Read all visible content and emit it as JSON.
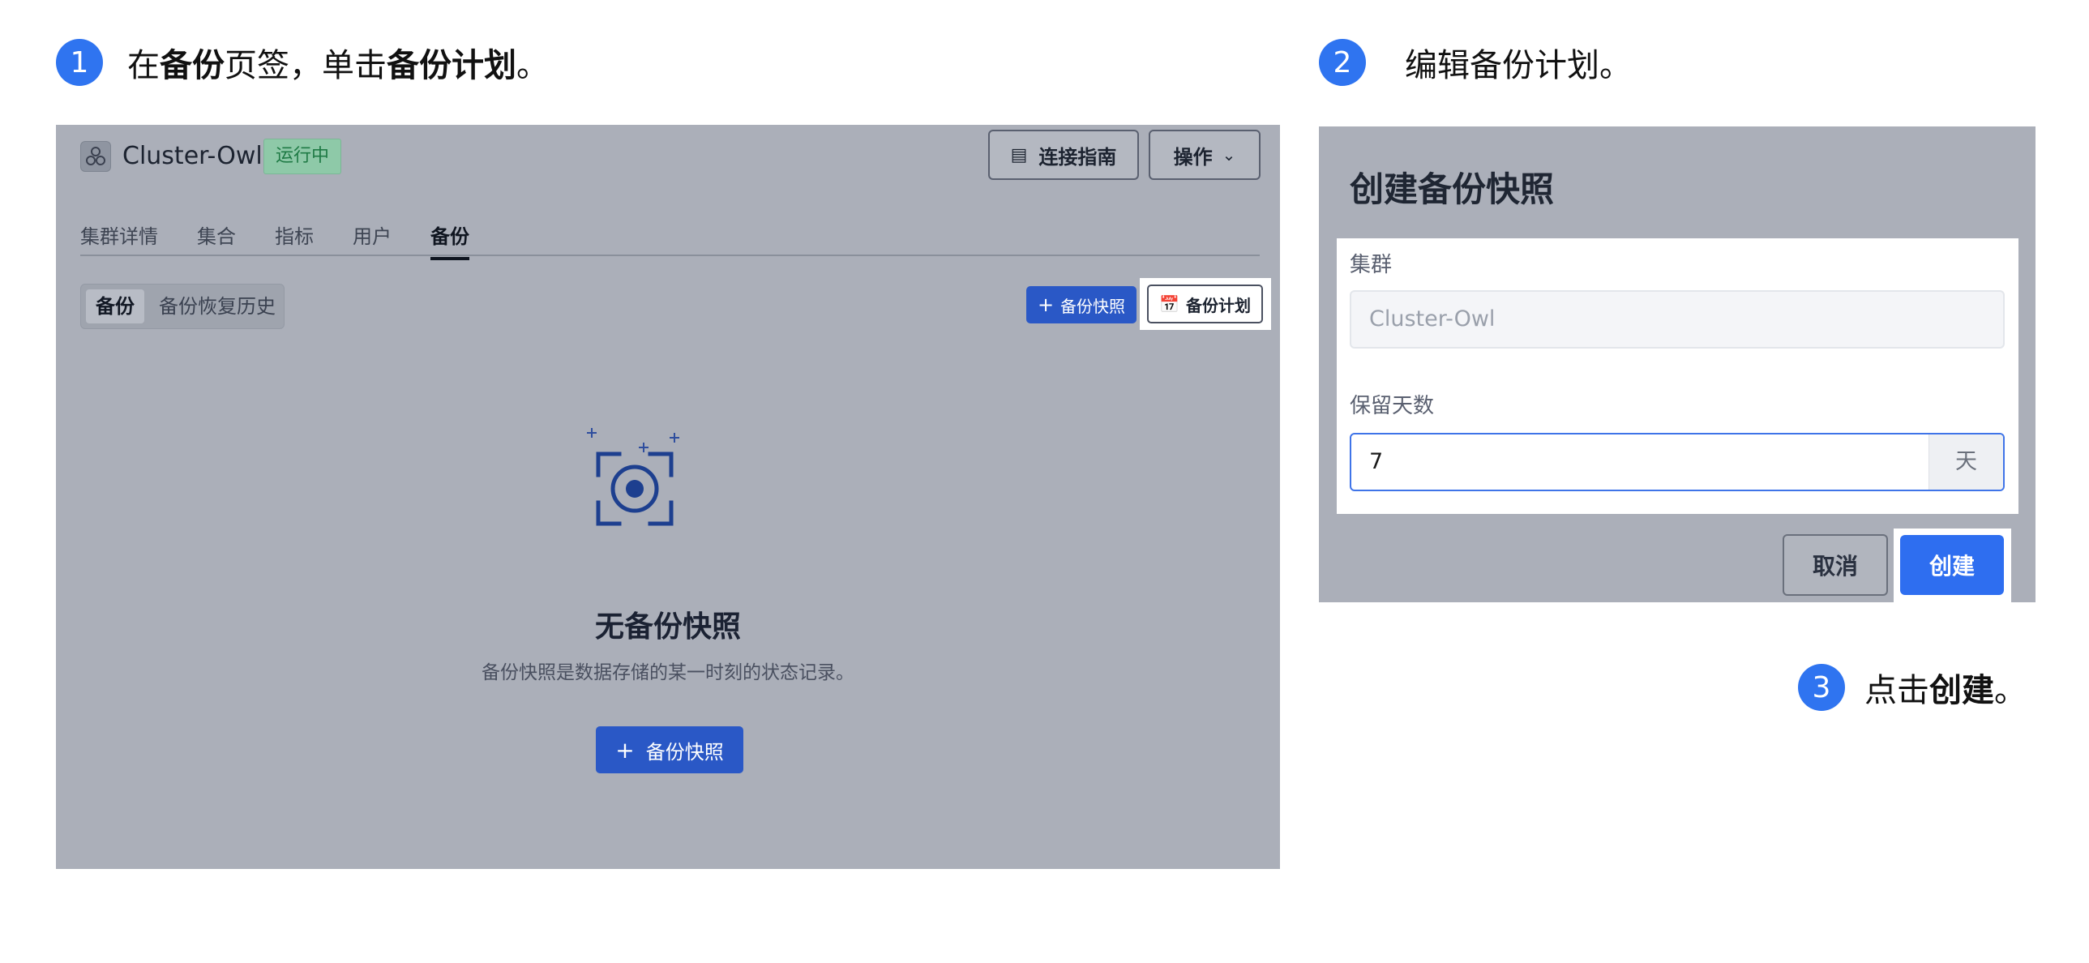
{
  "step1": {
    "number": "1",
    "text_pre": "在",
    "tab_name": "备份",
    "text_mid": "页签，单击",
    "button_name": "备份计划",
    "text_end": "。"
  },
  "step2": {
    "number": "2",
    "text": "编辑备份计划。"
  },
  "step3": {
    "number": "3",
    "text_pre": "点击",
    "button_name": "创建",
    "text_end": "。"
  },
  "panel1": {
    "cluster_name": "Cluster-Owl",
    "status": "运行中",
    "guide_button": "连接指南",
    "actions_button": "操作",
    "tabs": [
      "集群详情",
      "集合",
      "指标",
      "用户",
      "备份"
    ],
    "active_tab": "备份",
    "segment": {
      "active": "备份",
      "other": "备份恢复历史"
    },
    "snapshot_button_small": "备份快照",
    "plan_button": "备份计划",
    "empty_title": "无备份快照",
    "empty_desc": "备份快照是数据存储的某一时刻的状态记录。",
    "snapshot_button_main": "备份快照"
  },
  "panel2": {
    "dialog_title": "创建备份快照",
    "cluster_label": "集群",
    "cluster_value": "Cluster-Owl",
    "days_label": "保留天数",
    "days_value": "7",
    "days_unit": "天",
    "cancel_button": "取消",
    "create_button": "创建"
  },
  "colors": {
    "accent": "#2f74f0",
    "primary_button": "#2a58c6",
    "overlay": "#abafb9",
    "status_green": "#1f7a45"
  },
  "icons": {
    "cluster": "cluster-icon",
    "guide": "book-icon",
    "chevron": "chevron-down-icon",
    "plus": "plus-icon",
    "calendar": "calendar-icon",
    "empty": "camera-focus-icon"
  }
}
